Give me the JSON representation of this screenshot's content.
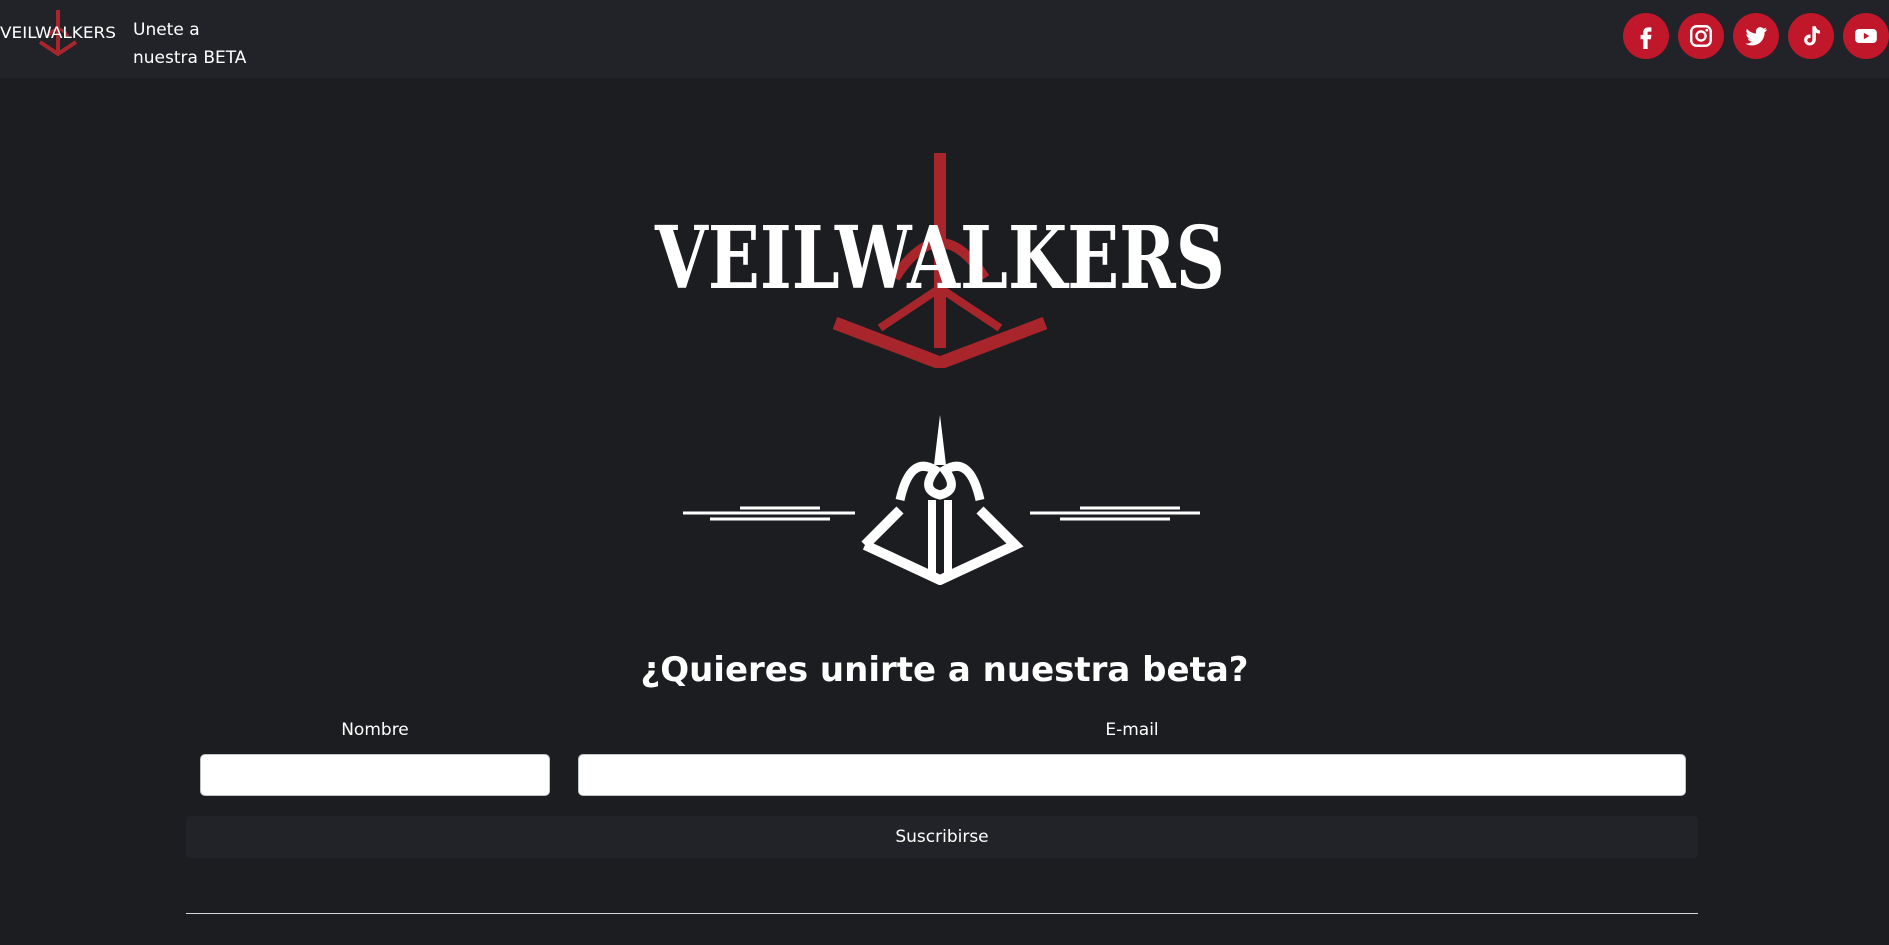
{
  "navbar": {
    "logo_text": "VEILWALKERS",
    "beta_link": "Unete a nuestra BETA",
    "socials": [
      {
        "name": "facebook-icon"
      },
      {
        "name": "instagram-icon"
      },
      {
        "name": "twitter-icon"
      },
      {
        "name": "tiktok-icon"
      },
      {
        "name": "youtube-icon"
      }
    ]
  },
  "hero": {
    "logo_text": "VEILWALKERS"
  },
  "form": {
    "heading": "¿Quieres unirte a nuestra beta?",
    "name_label": "Nombre",
    "name_value": "",
    "email_label": "E-mail",
    "email_value": "",
    "submit_label": "Suscribirse"
  },
  "colors": {
    "background": "#1b1d20",
    "navbar": "#212328",
    "accent_red": "#c0172a",
    "logo_red": "#a8262b"
  }
}
